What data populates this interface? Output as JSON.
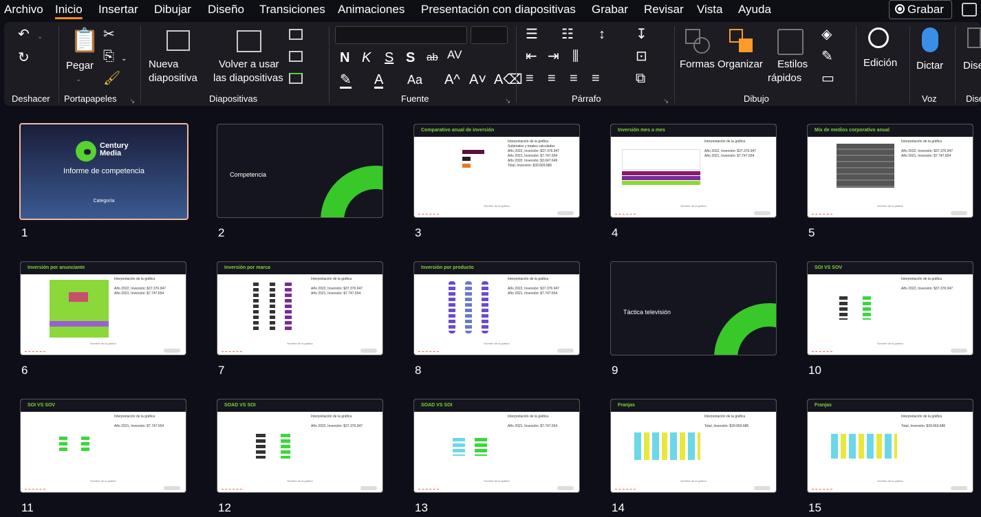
{
  "menu": [
    "Archivo",
    "Inicio",
    "Insertar",
    "Dibujar",
    "Diseño",
    "Transiciones",
    "Animaciones",
    "Presentación con diapositivas",
    "Grabar",
    "Revisar",
    "Vista",
    "Ayuda"
  ],
  "record_label": "Grabar",
  "ribbon": {
    "undo_group": "Deshacer",
    "clipboard": {
      "paste": "Pegar",
      "group": "Portapapeles"
    },
    "slides": {
      "new_line1": "Nueva",
      "new_line2": "diapositiva",
      "reuse_line1": "Volver a usar",
      "reuse_line2": "las diapositivas",
      "group": "Diapositivas"
    },
    "font": {
      "group": "Fuente",
      "bold": "N",
      "italic": "K",
      "underline": "S",
      "shadow": "S",
      "strike": "ab",
      "spacing": "AV",
      "case": "Aa"
    },
    "paragraph": {
      "group": "Párrafo"
    },
    "drawing": {
      "shapes": "Formas",
      "arrange": "Organizar",
      "styles_line1": "Estilos",
      "styles_line2": "rápidos",
      "group": "Dibujo"
    },
    "editing": {
      "label": "Edición"
    },
    "voice": {
      "dictate": "Dictar",
      "group": "Voz"
    },
    "designer": {
      "label": "Dise",
      "group": "Dise"
    }
  },
  "slides": [
    {
      "n": "1",
      "title": "Informe de competencia",
      "sub": "Categoría",
      "brand": "Century Media"
    },
    {
      "n": "2",
      "title": "Competencia"
    },
    {
      "n": "3",
      "title": "Comparativo anual de inversión"
    },
    {
      "n": "4",
      "title": "Inversión mes a mes"
    },
    {
      "n": "5",
      "title": "Mix de medios corporativo anual"
    },
    {
      "n": "6",
      "title": "Inversión por anunciante"
    },
    {
      "n": "7",
      "title": "Inversión por marca"
    },
    {
      "n": "8",
      "title": "Inversión por producto"
    },
    {
      "n": "9",
      "title": "Táctica televisión"
    },
    {
      "n": "10",
      "title": "SOI VS SOV"
    },
    {
      "n": "11",
      "title": "SOI VS SOV"
    },
    {
      "n": "12",
      "title": "SOAD VS SOI"
    },
    {
      "n": "13",
      "title": "SOAD VS SOI"
    },
    {
      "n": "14",
      "title": "Franjas"
    },
    {
      "n": "15",
      "title": "Franjas"
    }
  ],
  "slide_text": {
    "interp": "Interpretación de la gráfica",
    "subtotals": "Subtotales y totales calculados",
    "y2022": "Año 2022, Inversión: $37.376.947",
    "y2021": "Año 2021, Inversión: $7.747.654",
    "y2020": "Año 2020, Inversión: $3.047.649",
    "total": "Total, Inversión: $39.669.686",
    "src": "Nombre de la gráfica"
  },
  "colors": {
    "accent": "#ff8c1a",
    "green": "#59d12f",
    "header": "#15151f"
  }
}
